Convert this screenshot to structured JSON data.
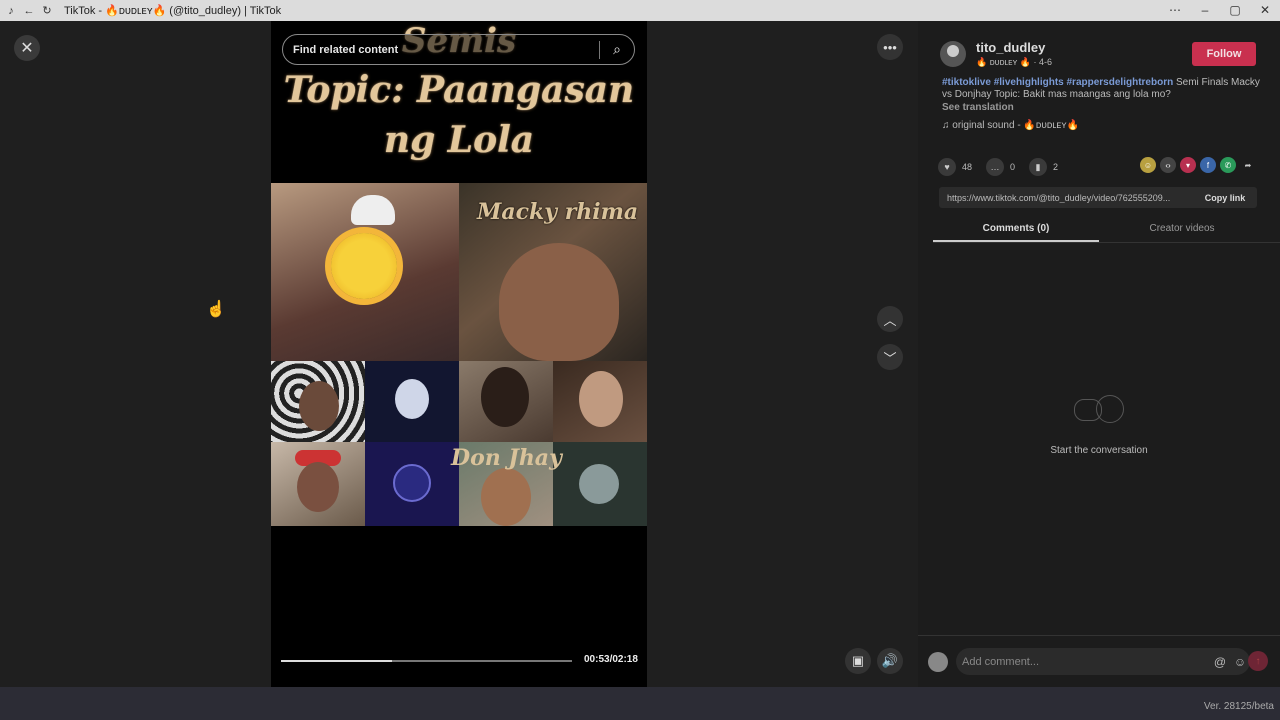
{
  "window": {
    "title": "TikTok - 🔥ᴅᴜᴅʟᴇʏ🔥 (@tito_dudley) | TikTok",
    "controls": [
      "⋯",
      "–",
      "▢",
      "✕"
    ]
  },
  "video": {
    "search_placeholder": "Find related content",
    "captions": [
      "Semis",
      "Topic: Paangasan",
      "ng Lola"
    ],
    "labels": {
      "top_right": "Macky rhima",
      "bottom": "Don Jhay"
    },
    "time": "00:53/02:18",
    "progress": 0.38
  },
  "author": {
    "username": "tito_dudley",
    "display": "🔥 ᴅᴜᴅʟᴇʏ 🔥",
    "date": "· 4-6",
    "follow_label": "Follow"
  },
  "post": {
    "tags": [
      "#tiktoklive",
      "#livehighlights",
      "#rappersdelightreborn"
    ],
    "text": "Semi Finals Macky vs Donjhay Topic: Bakit mas maangas ang lola mo?",
    "see_translation": "See translation",
    "sound": "original sound - 🔥ᴅᴜᴅʟᴇʏ🔥"
  },
  "metrics": {
    "likes": "48",
    "comments": "0",
    "saves": "2"
  },
  "link": {
    "url": "https://www.tiktok.com/@tito_dudley/video/762555209...",
    "copy_label": "Copy link"
  },
  "tabs": [
    "Comments (0)",
    "Creator videos"
  ],
  "empty_state": "Start the conversation",
  "comment_placeholder": "Add comment...",
  "version": "Ver. 28125/beta",
  "colors": {
    "follow": "#c9304f",
    "tag": "#7b9bd6",
    "caption": "#e2c69a"
  }
}
